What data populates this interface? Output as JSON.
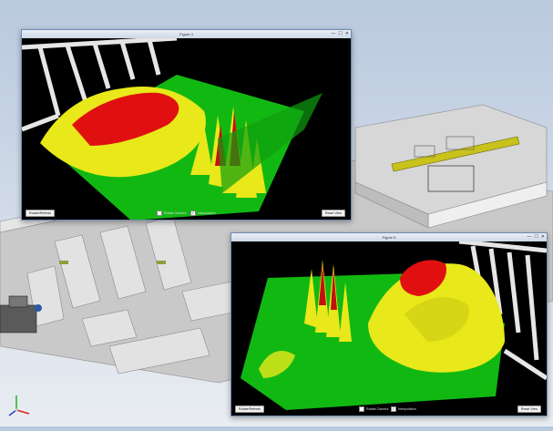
{
  "windows": [
    {
      "id": "figure-top",
      "title": "Figure 4",
      "controls": {
        "minimize": "—",
        "maximize": "☐",
        "close": "✕"
      },
      "buttons": {
        "left": "Rotate/Refresh",
        "right": "Reset View"
      },
      "toggles": [
        {
          "label": "Rotate Camera",
          "checked": false
        },
        {
          "label": "Interpolation",
          "checked": true
        }
      ]
    },
    {
      "id": "figure-bottom",
      "title": "Figure 5",
      "controls": {
        "minimize": "—",
        "maximize": "☐",
        "close": "✕"
      },
      "buttons": {
        "left": "Rotate/Refresh",
        "right": "Reset View"
      },
      "toggles": [
        {
          "label": "Rotate Camera",
          "checked": false
        },
        {
          "label": "Interpolation",
          "checked": true
        }
      ]
    }
  ],
  "colors": {
    "surface_low": "#12b812",
    "surface_mid": "#e8e81a",
    "surface_high": "#e01010",
    "background_cad": "#cfd9e7",
    "canvas_bg": "#000000"
  },
  "icons": [
    "axis-triad-icon",
    "close-icon",
    "maximize-icon",
    "minimize-icon"
  ]
}
